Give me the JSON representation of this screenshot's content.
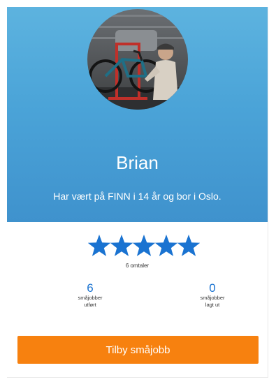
{
  "profile": {
    "name": "Brian",
    "tagline": "Har vært på FINN i 14 år og bor i Oslo."
  },
  "rating": {
    "stars": 5,
    "max_stars": 5,
    "reviews_label": "6 omtaler",
    "star_color": "#1a73d1"
  },
  "stats": [
    {
      "value": "6",
      "line1": "småjobber",
      "line2": "utført"
    },
    {
      "value": "0",
      "line1": "småjobber",
      "line2": "lagt ut"
    }
  ],
  "cta": {
    "label": "Tilby småjobb",
    "color": "#f7810f"
  },
  "avatar": {
    "icon": "user-photo"
  }
}
